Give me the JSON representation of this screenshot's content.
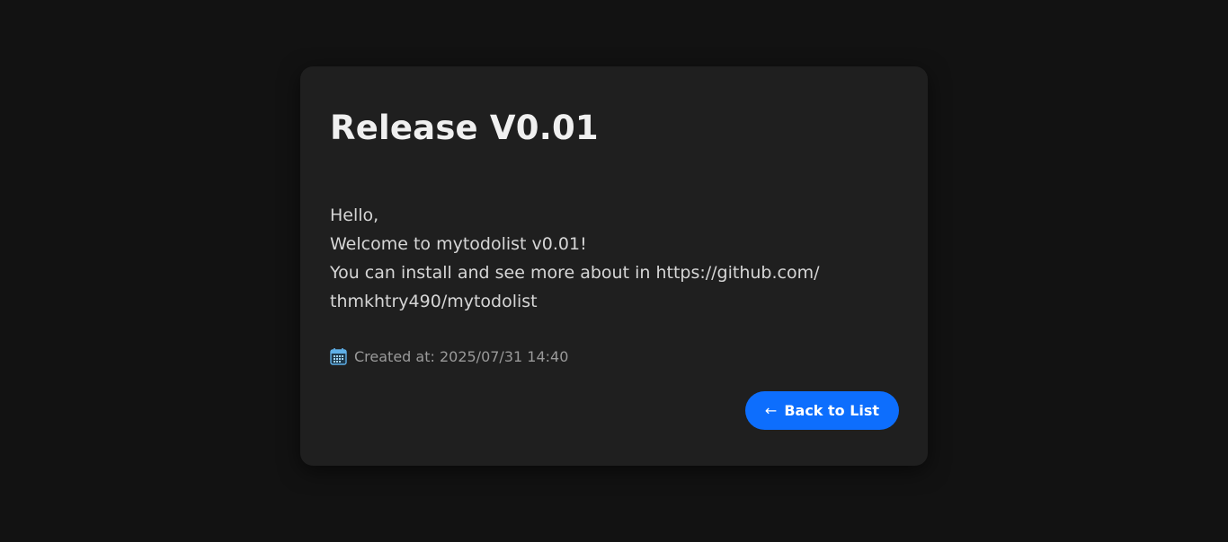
{
  "note": {
    "title": "Release V0.01",
    "body_lines": [
      "Hello,",
      "Welcome to mytodolist v0.01!",
      "You can install and see more about in https://github.com/",
      "thmkhtry490/mytodolist"
    ],
    "created_label": "Created at: 2025/07/31 14:40"
  },
  "actions": {
    "back_label": "Back to List",
    "back_icon": "arrow-left-icon"
  },
  "icons": {
    "created": "calendar-icon"
  },
  "colors": {
    "background": "#121212",
    "card": "#1f1f1f",
    "accent": "#0d6efd",
    "calendar_icon": "#5fb0e8"
  }
}
